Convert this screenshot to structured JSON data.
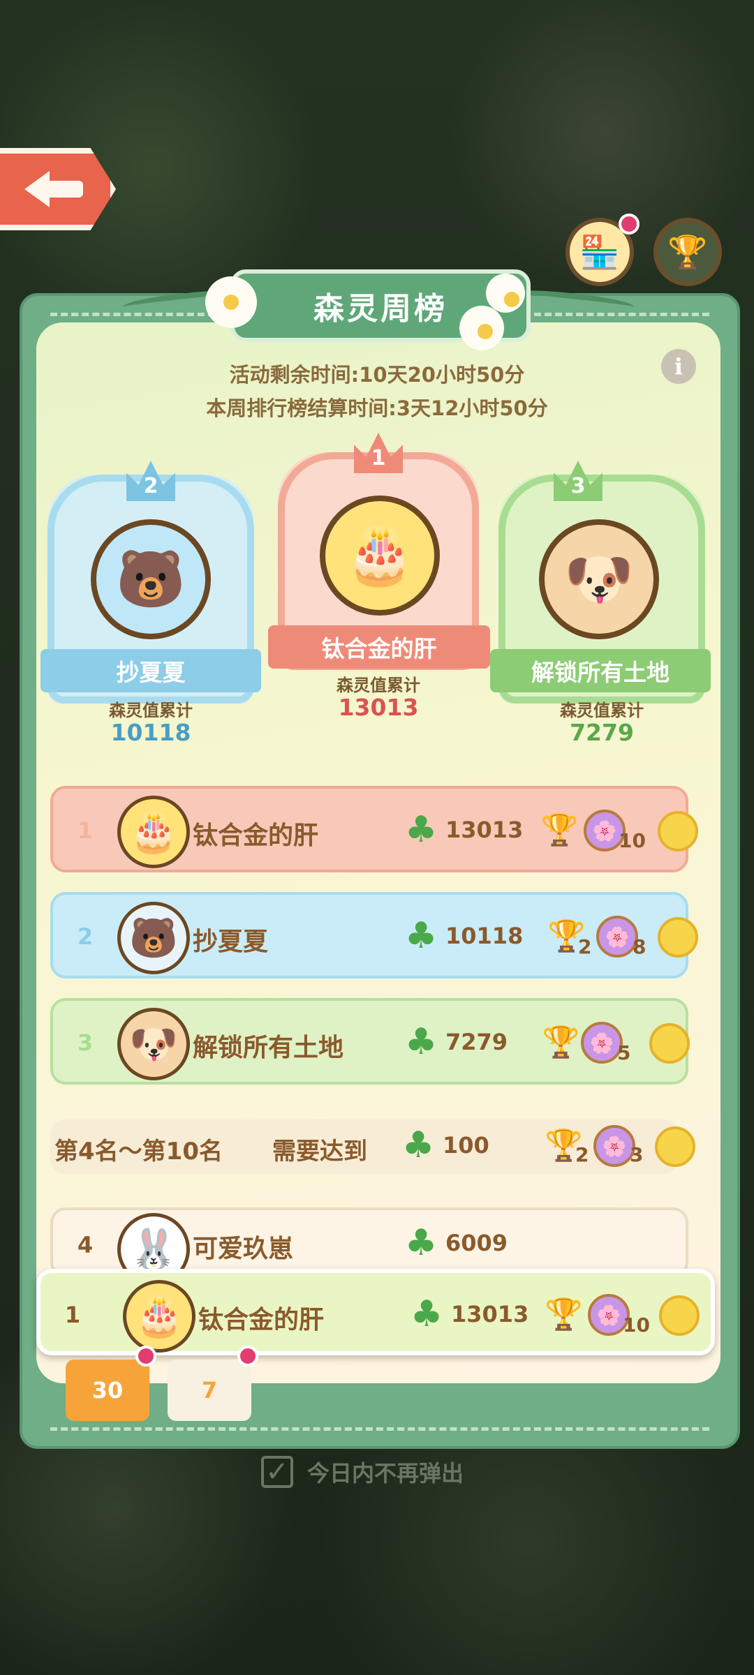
{
  "header": {
    "title": "森灵周榜",
    "back_label": "back"
  },
  "timers": {
    "remaining": "活动剩余时间:10天20小时50分",
    "settlement": "本周排行榜结算时间:3天12小时50分"
  },
  "podium": {
    "first": {
      "rank": "1",
      "name": "钛合金的肝",
      "score_label": "森灵值累计",
      "score": "13013"
    },
    "second": {
      "rank": "2",
      "name": "抄夏夏",
      "score_label": "森灵值累计",
      "score": "10118"
    },
    "third": {
      "rank": "3",
      "name": "解锁所有土地",
      "score_label": "森灵值累计",
      "score": "7279"
    }
  },
  "rows": [
    {
      "rank": "1",
      "name": "钛合金的肝",
      "score": "13013",
      "basket_count": "10",
      "cup_count": ""
    },
    {
      "rank": "2",
      "name": "抄夏夏",
      "score": "10118",
      "cup_count": "2",
      "basket_count": "8"
    },
    {
      "rank": "3",
      "name": "解锁所有土地",
      "score": "7279",
      "cup_count": "",
      "basket_count": "5"
    }
  ],
  "tier_row": {
    "label": "第4名～第10名",
    "need": "需要达到",
    "score": "100",
    "cup_count": "2",
    "basket_count": "3"
  },
  "fourth_row": {
    "rank": "4",
    "name": "可爱玖崽",
    "score": "6009"
  },
  "my_row": {
    "rank": "1",
    "name": "钛合金的肝",
    "score": "13013",
    "basket_count": "10"
  },
  "tabs": {
    "monthly": "30",
    "weekly": "7"
  },
  "footer": {
    "dont_show": "今日内不再弹出"
  },
  "colors": {
    "panel": "#6fae86",
    "gold_row": "#f8c9b8",
    "silver_row": "#c9ecf8",
    "bronze_row": "#dff2c5",
    "first_score": "#d9534f",
    "second_score": "#4a9ec2",
    "third_score": "#5aa84a"
  },
  "icons": [
    "back-arrow-icon",
    "shop-icon",
    "trophy-icon",
    "info-icon",
    "clover-icon",
    "cup-icon",
    "basket-icon",
    "coin-icon",
    "calendar-icon",
    "checkbox-icon"
  ]
}
